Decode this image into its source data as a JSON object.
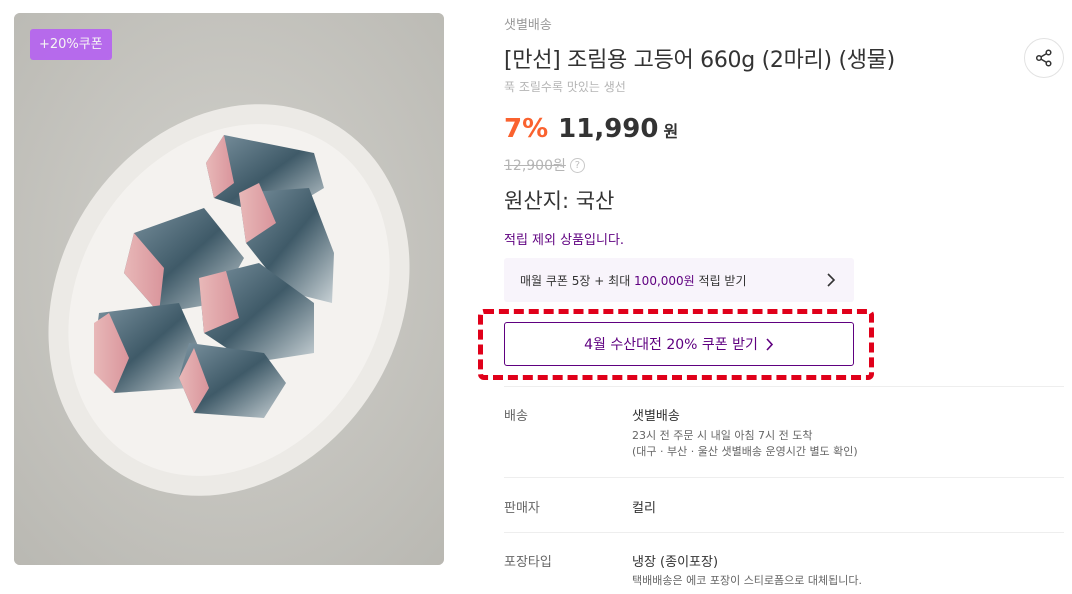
{
  "product": {
    "coupon_tag": "+20%쿠폰",
    "delivery_type": "샛별배송",
    "title": "[만선] 조림용 고등어 660g (2마리) (생물)",
    "subtitle": "푹 조릴수록 맛있는 생선",
    "discount": "7%",
    "price": "11,990",
    "currency": "원",
    "original_price": "12,900원",
    "help_icon_glyph": "?",
    "origin": "원산지: 국산",
    "point_notice": "적립 제외 상품입니다."
  },
  "benefit": {
    "text_prefix": "매월 쿠폰 5장 + 최대 ",
    "text_highlight": "100,000원",
    "text_suffix": " 적립 받기",
    "chevron": "›"
  },
  "coupon_button": {
    "label": "4월 수산대전 20% 쿠폰 받기",
    "chevron": "›"
  },
  "details": {
    "delivery": {
      "label": "배송",
      "value": "샛별배송",
      "sub1": "23시 전 주문 시 내일 아침 7시 전 도착",
      "sub2": "(대구 · 부산 · 울산 샛별배송 운영시간 별도 확인)"
    },
    "seller": {
      "label": "판매자",
      "value": "컬리"
    },
    "packaging": {
      "label": "포장타입",
      "value": "냉장 (종이포장)",
      "sub1": "택배배송은 에코 포장이 스티로폼으로 대체됩니다."
    }
  },
  "colors": {
    "brand_purple": "#5f0080",
    "discount_orange": "#fa622f",
    "coupon_tag": "#b55cf5",
    "highlight_red": "#e0001a"
  },
  "icons": {
    "share": "share-icon",
    "help": "question-circle-icon",
    "benefit_chevron": "chevron-right-icon"
  }
}
